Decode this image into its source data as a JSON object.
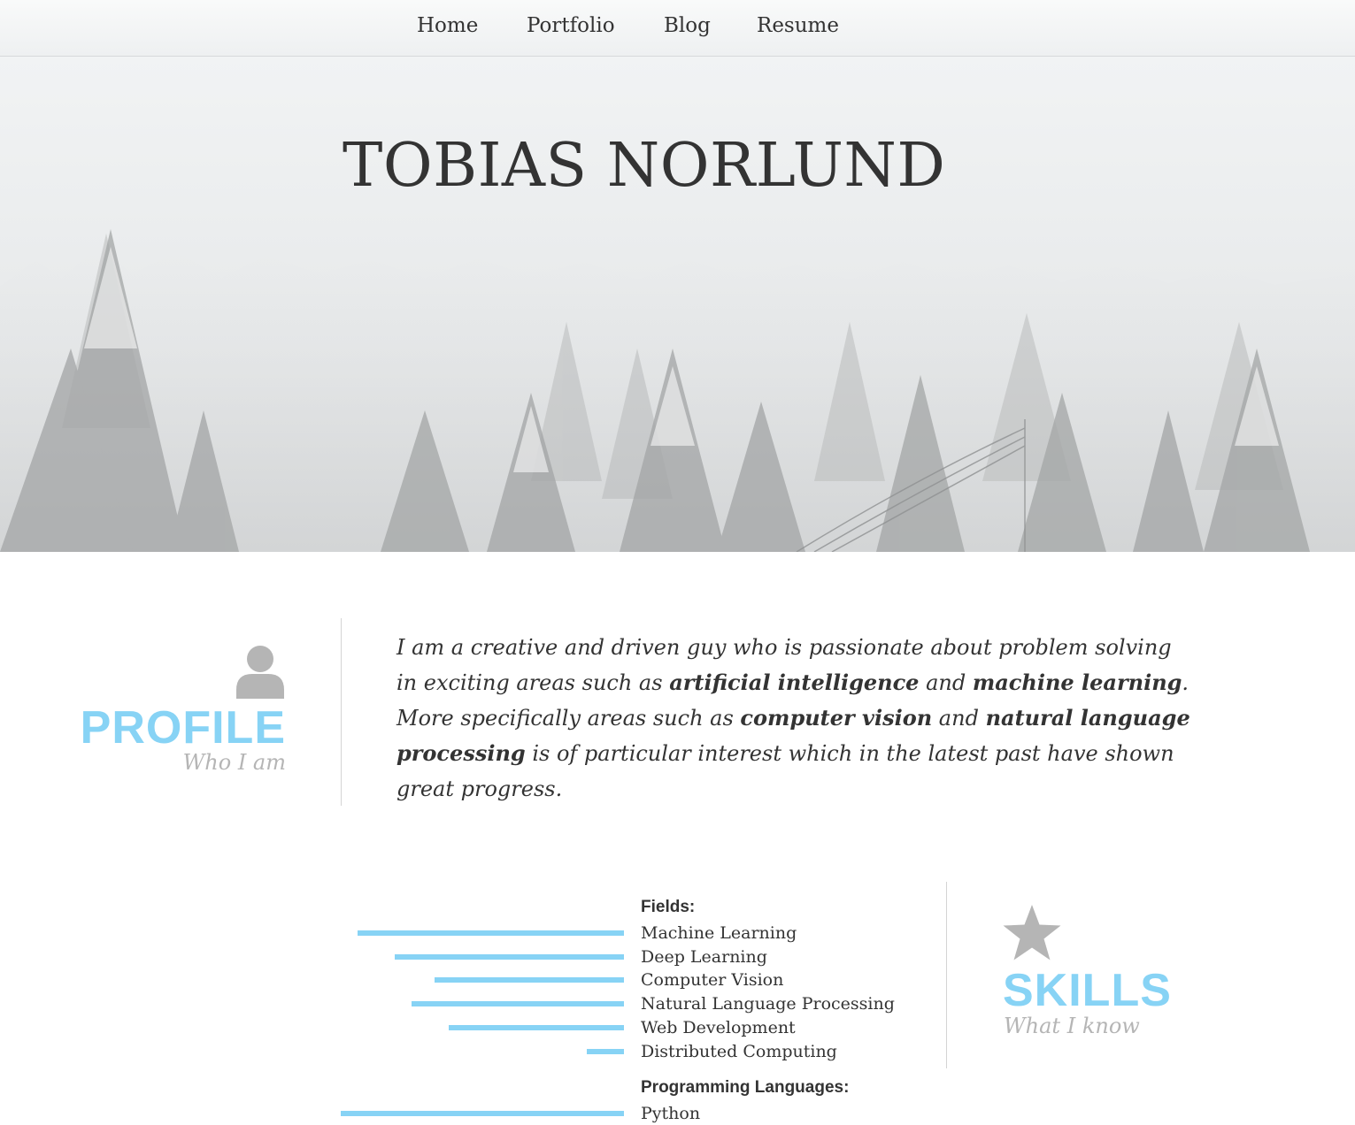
{
  "nav": {
    "items": [
      {
        "label": "Home"
      },
      {
        "label": "Portfolio"
      },
      {
        "label": "Blog"
      },
      {
        "label": "Resume"
      }
    ]
  },
  "hero": {
    "title": "TOBIAS NORLUND"
  },
  "profile": {
    "heading": "PROFILE",
    "subheading": "Who I am",
    "icon": "user-icon",
    "text": [
      {
        "t": "I am a creative and driven guy who is passionate about problem solving in exciting areas such as ",
        "bold": false
      },
      {
        "t": "artificial intelligence",
        "bold": true
      },
      {
        "t": " and ",
        "bold": false
      },
      {
        "t": "machine learning",
        "bold": true
      },
      {
        "t": ". More specifically areas such as ",
        "bold": false
      },
      {
        "t": "computer vision",
        "bold": true
      },
      {
        "t": " and ",
        "bold": false
      },
      {
        "t": "natural language processing",
        "bold": true
      },
      {
        "t": " is of particular interest which in the latest past have shown great progress.",
        "bold": false
      }
    ]
  },
  "skills": {
    "heading": "SKILLS",
    "subheading": "What I know",
    "icon": "star-icon",
    "bar_color": "#87d3f5",
    "groups": [
      {
        "title": "Fields:",
        "items": [
          {
            "label": "Machine Learning",
            "level": 0.94
          },
          {
            "label": "Deep Learning",
            "level": 0.81
          },
          {
            "label": "Computer Vision",
            "level": 0.67
          },
          {
            "label": "Natural Language Processing",
            "level": 0.75
          },
          {
            "label": "Web Development",
            "level": 0.62
          },
          {
            "label": "Distributed Computing",
            "level": 0.13
          }
        ]
      },
      {
        "title": "Programming Languages:",
        "items": [
          {
            "label": "Python",
            "level": 1.0
          }
        ]
      }
    ]
  }
}
